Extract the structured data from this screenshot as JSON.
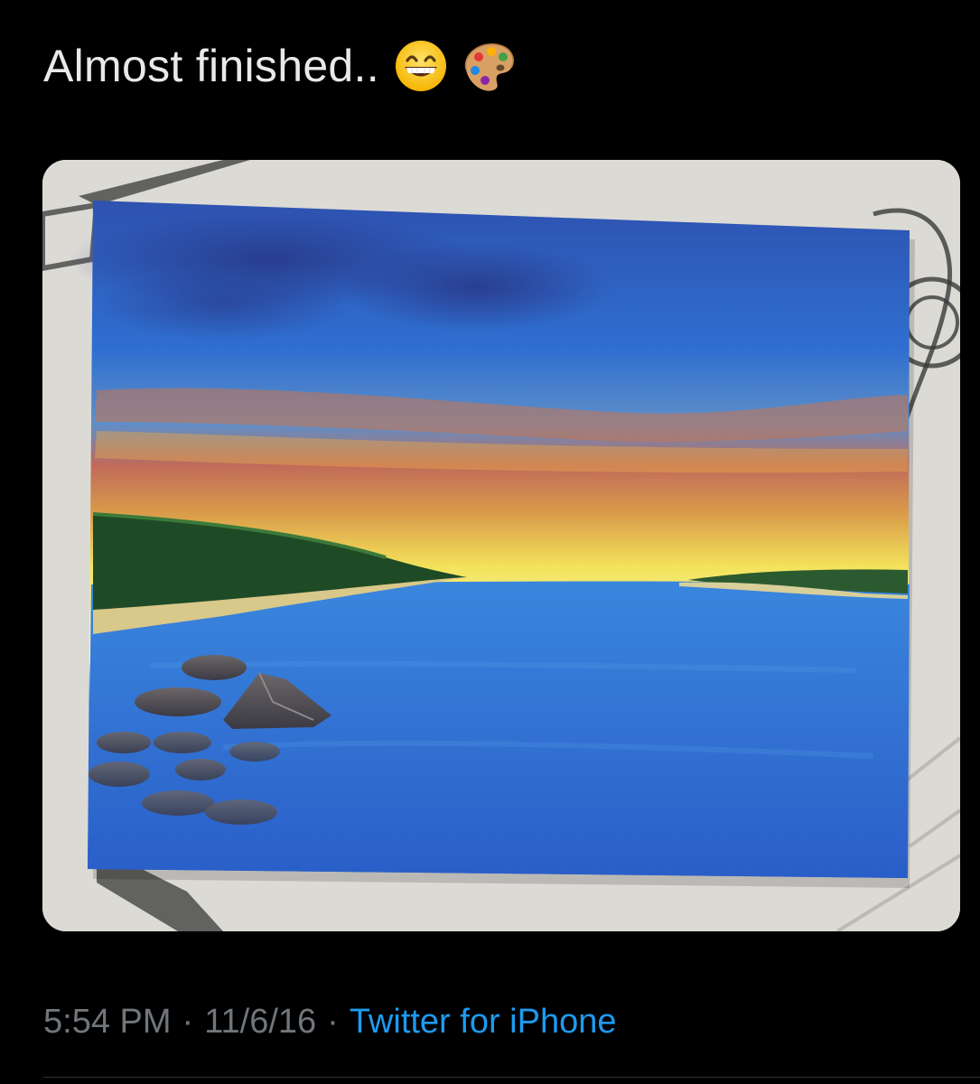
{
  "tweet": {
    "text": "Almost finished..",
    "emojis": [
      "grinning-face-with-smiling-eyes-icon",
      "artist-palette-icon"
    ],
    "time": "5:54 PM",
    "date": "11/6/16",
    "separator": "·",
    "source": "Twitter for iPhone",
    "source_color": "#1d9bf0"
  }
}
